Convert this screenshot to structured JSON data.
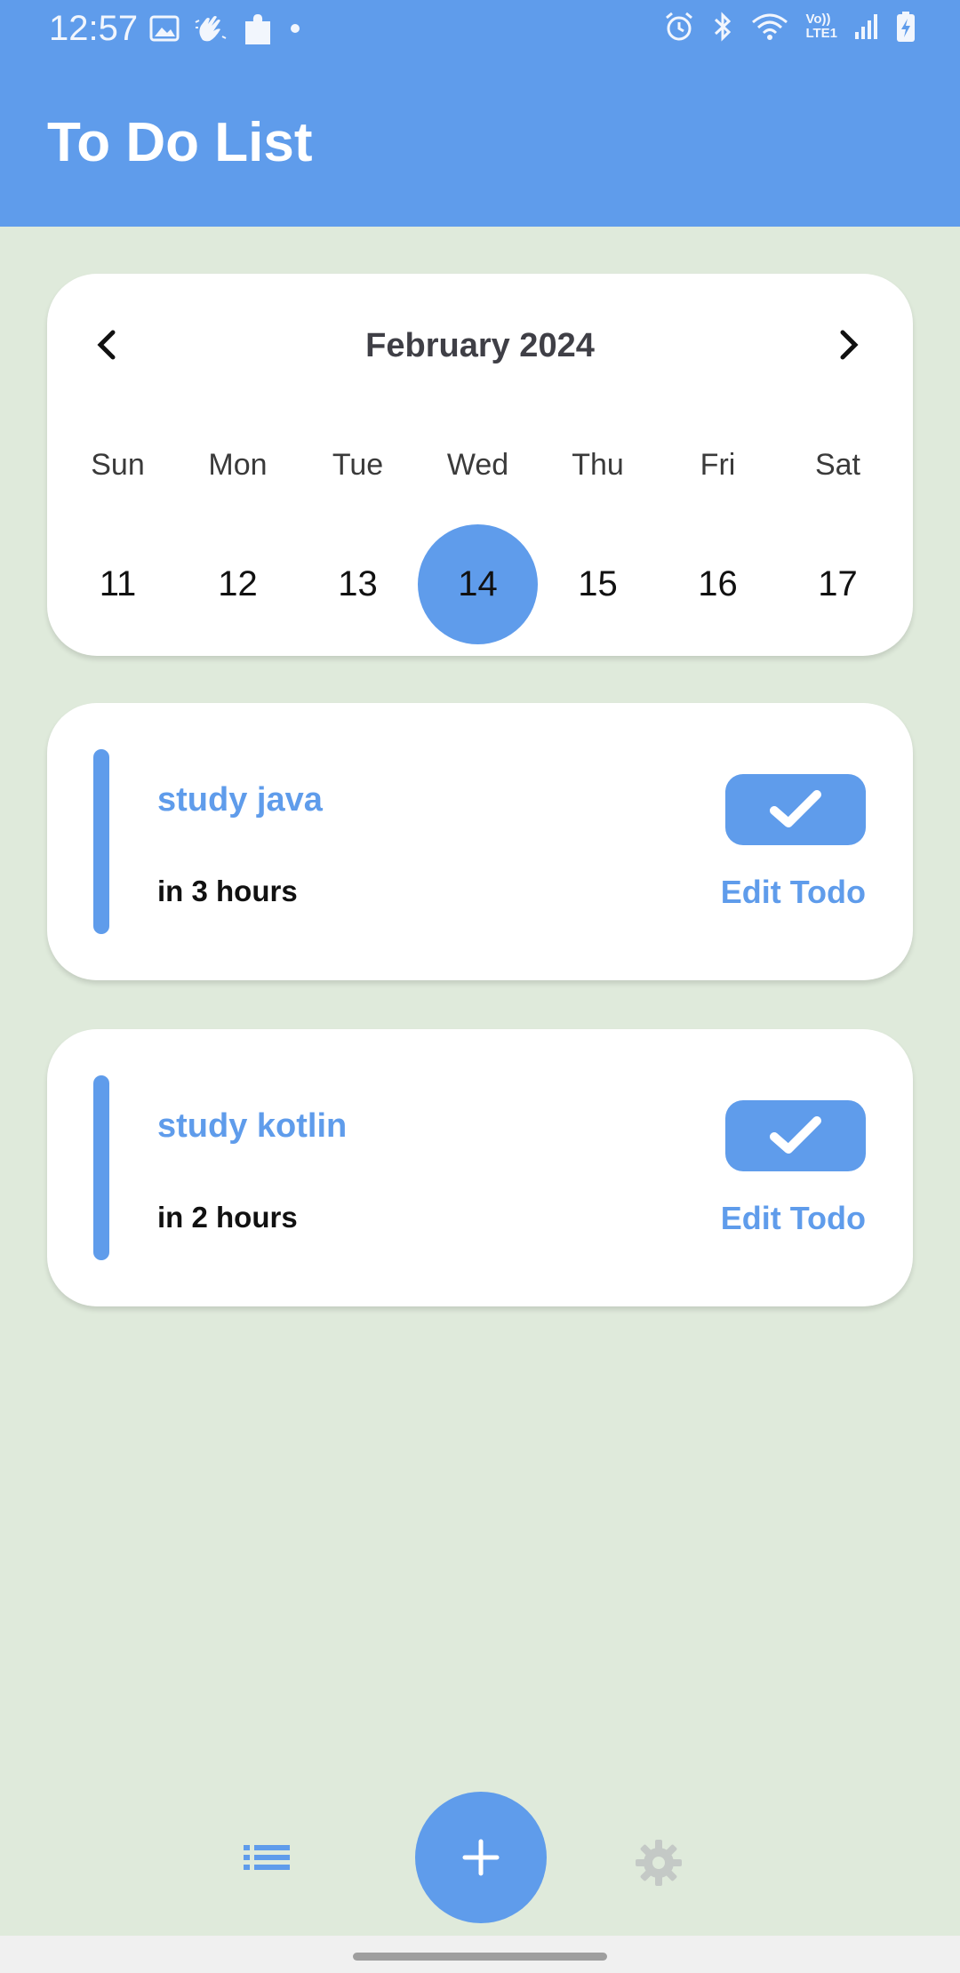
{
  "status_bar": {
    "time": "12:57",
    "left_icons": [
      "image-icon",
      "hand-wave-icon",
      "puzzle-icon",
      "dot-icon"
    ],
    "right_icons": [
      "alarm-icon",
      "bluetooth-icon",
      "wifi-icon",
      "volte-lte-icon",
      "signal-icon",
      "battery-charging-icon"
    ],
    "volte_text": "Vo))",
    "lte_text": "LTE1"
  },
  "app": {
    "title": "To Do List",
    "header_color": "#5f9ceb",
    "background_color": "#dfeadb"
  },
  "calendar": {
    "month_label": "February 2024",
    "prev_icon": "chevron-left-icon",
    "next_icon": "chevron-right-icon",
    "weekdays": [
      "Sun",
      "Mon",
      "Tue",
      "Wed",
      "Thu",
      "Fri",
      "Sat"
    ],
    "days": [
      "11",
      "12",
      "13",
      "14",
      "15",
      "16",
      "17"
    ],
    "selected_day": "14"
  },
  "todos": [
    {
      "title": "study java",
      "time": "in 3 hours",
      "edit_label": "Edit Todo",
      "check_icon": "checkmark-icon"
    },
    {
      "title": "study kotlin",
      "time": "in 2 hours",
      "edit_label": "Edit Todo",
      "check_icon": "checkmark-icon"
    }
  ],
  "bottom_nav": {
    "list_icon": "list-icon",
    "add_icon": "plus-icon",
    "settings_icon": "gear-icon"
  }
}
